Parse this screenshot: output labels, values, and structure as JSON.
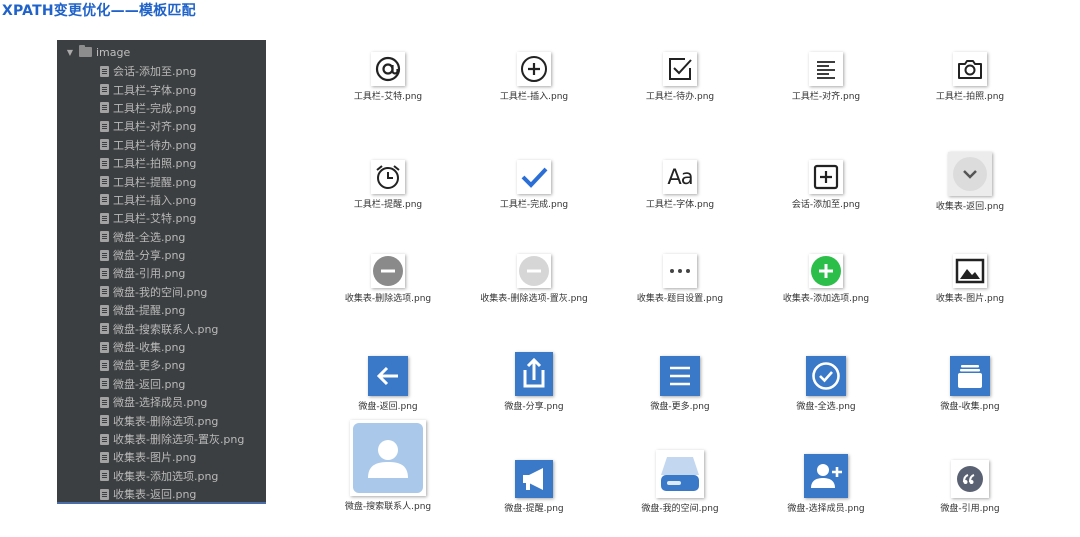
{
  "header": {
    "title": "XPATH变更优化——模板匹配"
  },
  "tree": {
    "root_label": "image",
    "files": [
      "会话-添加至.png",
      "工具栏-字体.png",
      "工具栏-完成.png",
      "工具栏-对齐.png",
      "工具栏-待办.png",
      "工具栏-拍照.png",
      "工具栏-提醒.png",
      "工具栏-插入.png",
      "工具栏-艾特.png",
      "微盘-全选.png",
      "微盘-分享.png",
      "微盘-引用.png",
      "微盘-我的空间.png",
      "微盘-提醒.png",
      "微盘-搜索联系人.png",
      "微盘-收集.png",
      "微盘-更多.png",
      "微盘-返回.png",
      "微盘-选择成员.png",
      "收集表-删除选项.png",
      "收集表-删除选项-置灰.png",
      "收集表-图片.png",
      "收集表-添加选项.png",
      "收集表-返回.png"
    ]
  },
  "grid": {
    "row1": [
      "工具栏-艾特.png",
      "工具栏-插入.png",
      "工具栏-待办.png",
      "工具栏-对齐.png",
      "工具栏-拍照.png"
    ],
    "row2": [
      "工具栏-提醒.png",
      "工具栏-完成.png",
      "工具栏-字体.png",
      "会话-添加至.png",
      "收集表-返回.png"
    ],
    "row3": [
      "收集表-删除选项.png",
      "收集表-删除选项-置灰.png",
      "收集表-题目设置.png",
      "收集表-添加选项.png",
      "收集表-图片.png"
    ],
    "row4": [
      "微盘-返回.png",
      "微盘-分享.png",
      "微盘-更多.png",
      "微盘-全选.png",
      "微盘-收集.png"
    ],
    "row5": [
      "微盘-搜索联系人.png",
      "微盘-提醒.png",
      "微盘-我的空间.png",
      "微盘-选择成员.png",
      "微盘-引用.png"
    ]
  },
  "glyphs": {
    "font_icon": "Aa"
  },
  "colors": {
    "title_blue": "#1f62c9",
    "weipan_blue": "#3a78c8",
    "check_blue": "#2b6fd6",
    "add_green": "#2bbf4a",
    "avatar_light_blue": "#a9c8ea"
  }
}
